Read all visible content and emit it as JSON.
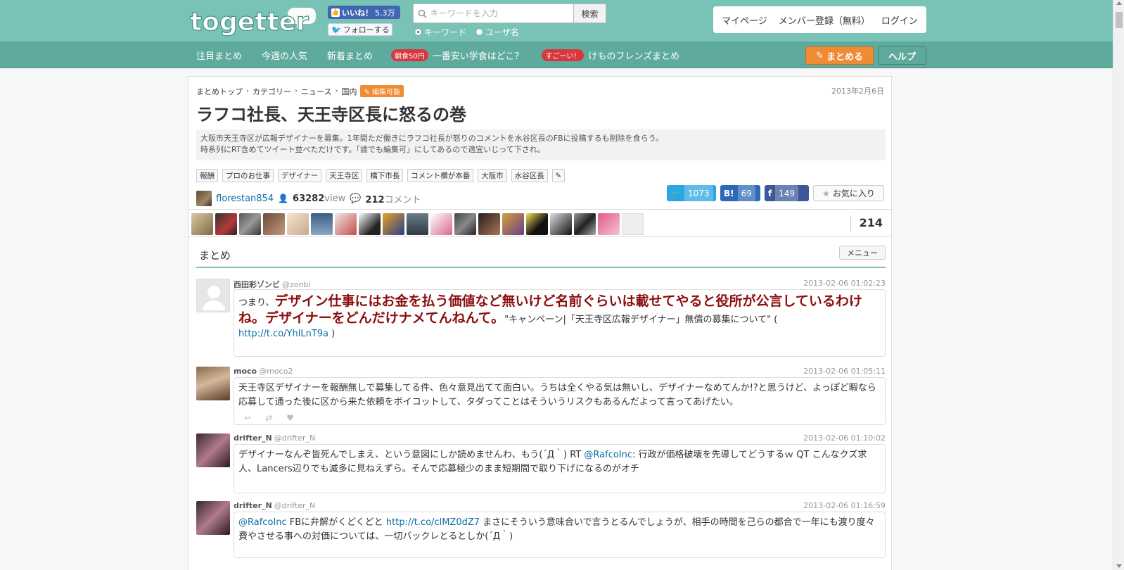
{
  "header": {
    "logo_text": "togetter",
    "fb_like": {
      "label": "いいね！",
      "count": "5.3万"
    },
    "tw_follow": "フォローする",
    "search": {
      "placeholder": "キーワードを入力",
      "button": "検索",
      "options": [
        "キーワード",
        "ユーザ名"
      ],
      "selected": "キーワード"
    },
    "account": [
      "マイページ",
      "メンバー登録（無料）",
      "ログイン"
    ]
  },
  "nav": {
    "items": [
      {
        "label": "注目まとめ"
      },
      {
        "label": "今週の人気"
      },
      {
        "label": "新着まとめ"
      },
      {
        "badge": "朝食50円",
        "label": "一番安い学食はどこ？"
      },
      {
        "badge": "すごーい！",
        "label": "けものフレンズまとめ"
      }
    ],
    "matome_button": "まとめる",
    "help_button": "ヘルプ"
  },
  "article": {
    "breadcrumb": [
      "まとめトップ",
      "カテゴリー",
      "ニュース",
      "国内"
    ],
    "edit_badge": "編集可能",
    "date": "2013年2月6日",
    "title": "ラフコ社長、天王寺区長に怒るの巻",
    "description_line1": "大阪市天王寺区が広報デザイナーを募集。1年間ただ働きにラフコ社長が怒りのコメントを水谷区長のFBに投稿するも削除を食らう。",
    "description_line2": "時系列にRT含めてツイート並べただけです。「誰でも編集可」にしてあるので適宜いじって下され。",
    "tags": [
      "報酬",
      "プロのお仕事",
      "デザイナー",
      "天王寺区",
      "橋下市長",
      "コメント欄が本番",
      "大阪市",
      "水谷区長"
    ],
    "author": "florestan854",
    "views": "63282",
    "views_unit": "view",
    "comments": "212",
    "comments_unit": "コメント",
    "share": {
      "twitter": "1073",
      "hatena": "69",
      "facebook": "149"
    },
    "fav_button": "お気に入り",
    "fav_total": "214",
    "section_title": "まとめ",
    "menu_button": "メニュー"
  },
  "tweets": [
    {
      "name": "西田彩ゾンビ",
      "handle": "@zonbi",
      "time": "2013-02-06 01:02:23",
      "prefix": "つまり、",
      "big": "デザイン仕事にはお金を払う価値など無いけど名前ぐらいは載せてやると役所が公言しているわけね。デザイナーをどんだけナメてんねんて。",
      "suffix": "\"キャンペーン|「天王寺区広報デザイナー」無償の募集について\" (",
      "link": "http://t.co/YhlLnT9a",
      "end": ")"
    },
    {
      "name": "moco",
      "handle": "@moco2",
      "time": "2013-02-06 01:05:11",
      "text": "天王寺区デザイナーを報酬無しで募集してる件、色々意見出てて面白い。うちは全くやる気は無いし、デザイナーなめてんか!?と思うけど、よっぽど暇なら応募して通った後に区から来た依頼をボイコットして、タダってことはそういうリスクもあるんだよって言ってあげたい。"
    },
    {
      "name": "drifter_N",
      "handle": "@drifter_N",
      "time": "2013-02-06 01:10:02",
      "text1": "デザイナーなんぞ皆死んでしまえ、という意図にしか読めませんわ、もう(´Д｀) RT ",
      "mention": "@RafcoInc",
      "text2": ": 行政が価格破壊を先導してどうするｗ QT こんなクズ求人、Lancers辺りでも滅多に見ねえずら。そんで応募極少のまま短期間で取り下げになるのがオチ"
    },
    {
      "name": "drifter_N",
      "handle": "@drifter_N",
      "time": "2013-02-06 01:16:59",
      "mention": "@RafcoInc",
      "text1": " FBに弁解がくどくどと ",
      "link": "http://t.co/clMZ0dZ7",
      "text2": " まさにそういう意味合いで言うとるんでしょうが、相手の時間を己らの都合で一年にも渡り度々費やさせる事への対価については、一切バックレとるとしか(´Д｀)"
    }
  ],
  "colors": {
    "header": "#79c3b6",
    "nav": "#5eab9e",
    "accent_orange": "#f08a33",
    "emphasis_text": "#8b0d0d",
    "link": "#0a6ea5"
  }
}
